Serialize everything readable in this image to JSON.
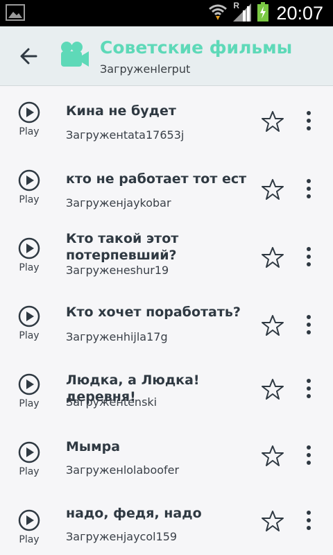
{
  "status_bar": {
    "time": "20:07",
    "network_letter": "R",
    "icons": [
      "gallery-icon",
      "wifi-icon",
      "signal-icon",
      "battery-charging-icon"
    ]
  },
  "app_bar": {
    "title": "Советские фильмы",
    "subtitle": "Загруженlerput",
    "back_icon": "arrow-left-icon",
    "category_icon": "video-camera-icon",
    "accent_color": "#5ed9b8"
  },
  "list": {
    "play_label": "Play",
    "items": [
      {
        "title": "Кина не будет",
        "uploader": "Загруженtata17653j"
      },
      {
        "title": "кто не работает тот ест",
        "uploader": "Загруженjaykobar"
      },
      {
        "title": "Кто такой этот потерпевший?",
        "uploader": "Загруженeshur19"
      },
      {
        "title": "Кто хочет поработать?",
        "uploader": "Загруженhijla17g"
      },
      {
        "title": "Людка, а Людка! деревня!",
        "uploader": "Загруженtenski"
      },
      {
        "title": "Мымра",
        "uploader": "Загруженlolaboofer"
      },
      {
        "title": "надо, федя, надо",
        "uploader": "Загруженjaycol159"
      }
    ]
  }
}
